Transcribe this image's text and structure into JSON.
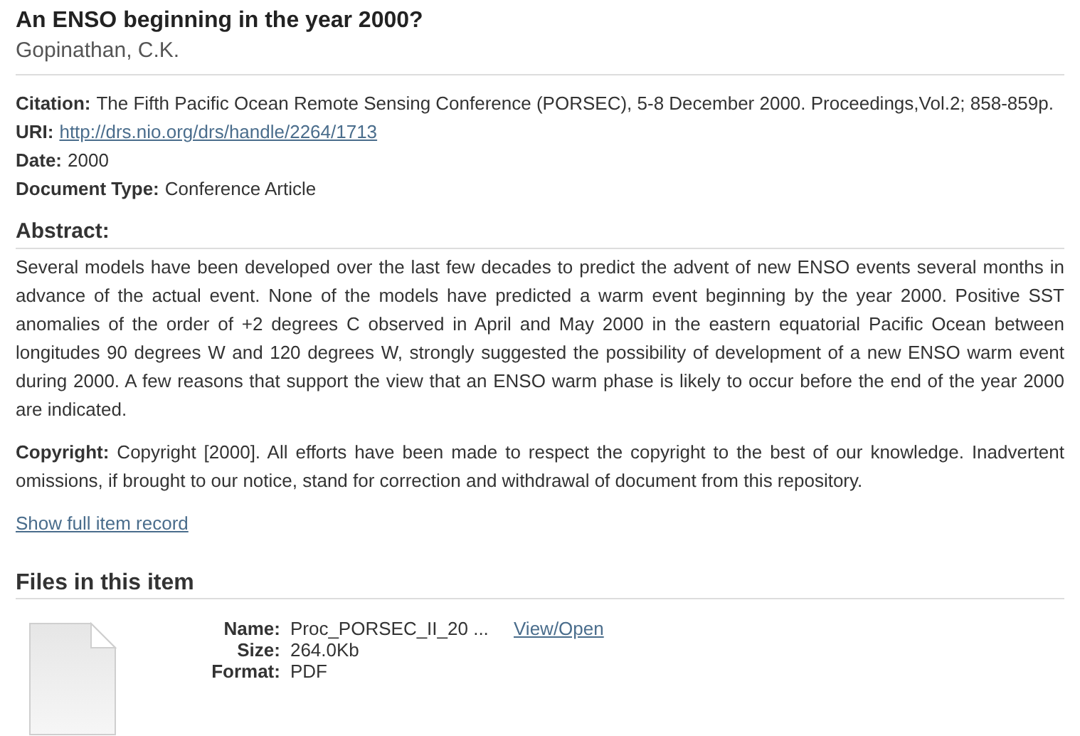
{
  "title": "An ENSO beginning in the year 2000?",
  "author": "Gopinathan, C.K.",
  "fields": [
    {
      "kind": "text",
      "label": "Citation:",
      "value": "The Fifth Pacific Ocean Remote Sensing Conference (PORSEC), 5-8 December 2000. Proceedings,Vol.2; 858-859p."
    },
    {
      "kind": "link",
      "label": "URI:",
      "value": "http://drs.nio.org/drs/handle/2264/1713"
    },
    {
      "kind": "text",
      "label": "Date:",
      "value": "2000"
    },
    {
      "kind": "text",
      "label": "Document Type:",
      "value": "Conference Article"
    }
  ],
  "abstract": {
    "heading": "Abstract:",
    "text": "Several models have been developed over the last few decades to predict the advent of new ENSO events several months in advance of the actual event. None of the models have predicted a warm event beginning by the year 2000. Positive SST anomalies of the order of +2 degrees C observed in April and May 2000 in the eastern equatorial Pacific Ocean between longitudes 90 degrees W and 120 degrees W, strongly suggested the possibility of development of a new ENSO warm event during 2000. A few reasons that support the view that an ENSO warm phase is likely to occur before the end of the year 2000 are indicated."
  },
  "copyright": "**Copyright:** Copyright [2000]. All efforts have been made to respect the copyright to the best of our knowledge. Inadvertent omissions, if brought to our notice, stand for correction and withdrawal of document from this repository.",
  "full_record_link": "Show full item record",
  "files": {
    "heading": "Files in this item",
    "items": [
      {
        "details": [
          {
            "label": "Name:",
            "value": "Proc_PORSEC_II_20 ..."
          },
          {
            "label": "Size:",
            "value": "264.0Kb"
          },
          {
            "label": "Format:",
            "value": "PDF"
          }
        ],
        "link": "View/Open"
      }
    ]
  }
}
